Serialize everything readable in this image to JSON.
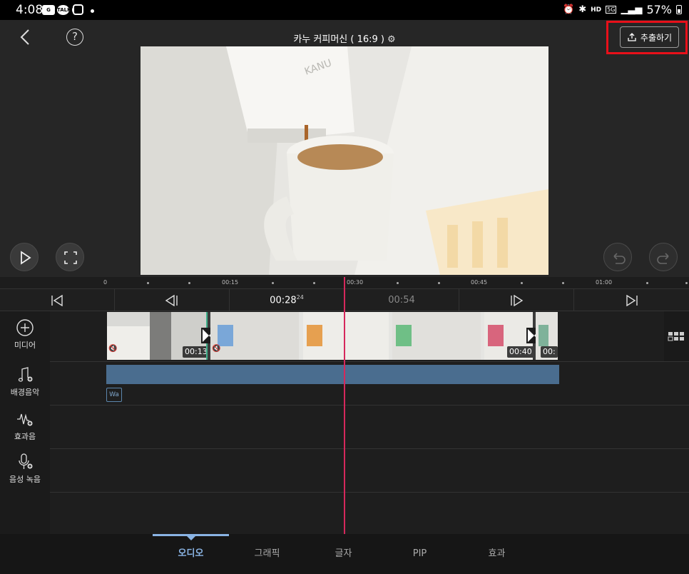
{
  "status_bar": {
    "time": "4:08",
    "apps": [
      "Google News",
      "TALK",
      "chat",
      "instagram"
    ],
    "battery": "57%",
    "network": "5G",
    "hd_voice": "HD"
  },
  "header": {
    "title": "카누 커피머신 ( 16:9 )",
    "export_label": "추출하기"
  },
  "ruler": {
    "labels": [
      "0",
      "00:15",
      "00:30",
      "00:45",
      "01:00"
    ]
  },
  "nav": {
    "playhead_time": "00:28",
    "playhead_frames": "24",
    "next_time": "00:54"
  },
  "sidebar": {
    "media_label": "미디어",
    "bgm_label": "배경음악",
    "sfx_label": "효과음",
    "voice_label": "음성 녹음"
  },
  "clips": [
    {
      "duration": "00:13"
    },
    {
      "duration": "00:40"
    },
    {
      "duration": "00:"
    }
  ],
  "audio": {
    "tag": "Wa"
  },
  "tabs": [
    {
      "label": "오디오"
    },
    {
      "label": "그래픽"
    },
    {
      "label": "글자"
    },
    {
      "label": "PIP"
    },
    {
      "label": "효과"
    }
  ],
  "colors": {
    "accent": "#8ab4e4",
    "playhead": "#d6285c",
    "audio_track": "#4a6d8f",
    "highlight": "#e8101a"
  }
}
